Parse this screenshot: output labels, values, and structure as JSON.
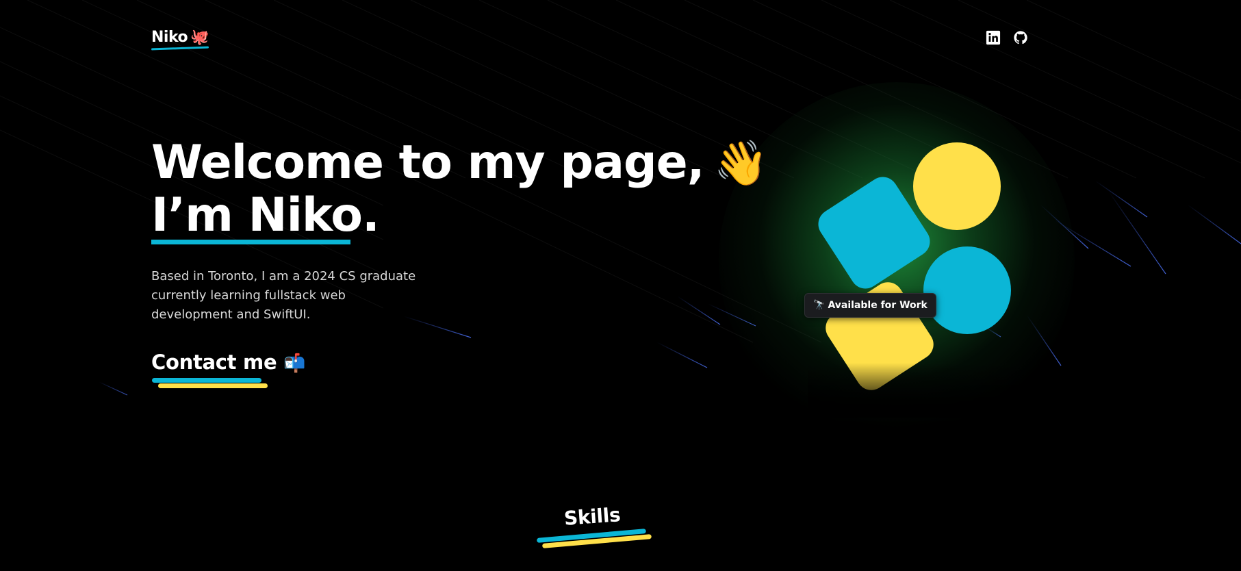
{
  "colors": {
    "background": "#000000",
    "accent_cyan": "#0bb6d6",
    "accent_yellow": "#ffe04a",
    "glow_green": "#22a042",
    "text": "#ffffff",
    "muted_text": "#d8d8d8"
  },
  "header": {
    "logo_text": "Niko",
    "logo_emoji": "🐙",
    "social": [
      {
        "name": "LinkedIn",
        "icon": "linkedin-icon"
      },
      {
        "name": "GitHub",
        "icon": "github-icon"
      }
    ]
  },
  "hero": {
    "title_line1": "Welcome to my page,",
    "title_emoji": "👋",
    "title_line2": "I’m Niko.",
    "bio": "Based in Toronto, I am a 2024 CS graduate currently learning fullstack web development and SwiftUI.",
    "contact_label": "Contact me",
    "contact_emoji": "📬"
  },
  "badge": {
    "emoji": "🔭",
    "label": "Available for Work"
  },
  "skills": {
    "title": "Skills"
  }
}
